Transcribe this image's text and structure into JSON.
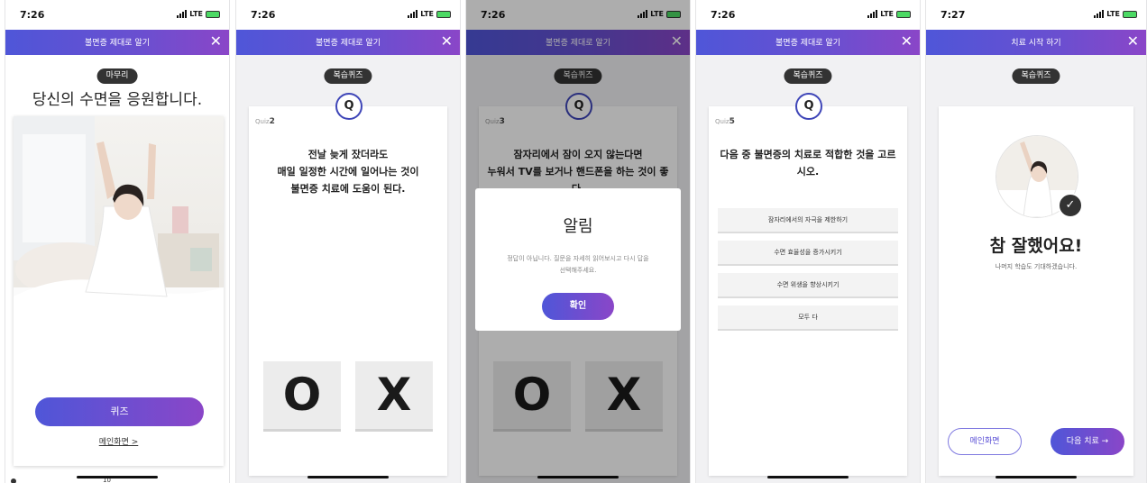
{
  "phones": [
    {
      "time": "7:26",
      "network": "LTE",
      "header_title": "불면증 제대로 알기",
      "close": "✕",
      "section_pill": "마무리",
      "heading": "당신의 수면을 응원합니다.",
      "quiz_button": "퀴즈",
      "main_link": "메인화면 >",
      "bottom_count": "10"
    },
    {
      "time": "7:26",
      "network": "LTE",
      "header_title": "불면증 제대로 알기",
      "close": "✕",
      "section_pill": "복습퀴즈",
      "q_badge": "Q",
      "quiz_prefix": "Quiz",
      "quiz_number": "2",
      "question_lines": [
        "전날 늦게 잤더라도",
        "매일 일정한 시간에 일어나는 것이",
        "불면증 치료에 도움이 된다."
      ],
      "o_label": "O",
      "x_label": "X"
    },
    {
      "time": "7:26",
      "network": "LTE",
      "header_title": "불면증 제대로 알기",
      "close": "✕",
      "section_pill": "복습퀴즈",
      "q_badge": "Q",
      "quiz_prefix": "Quiz",
      "quiz_number": "3",
      "question_lines": [
        "잠자리에서 잠이 오지 않는다면",
        "누워서 TV를 보거나 핸드폰을 하는 것이 좋",
        "다."
      ],
      "o_label": "O",
      "x_label": "X",
      "alert_title": "알림",
      "alert_lines": [
        "정답이 아닙니다. 질문을 자세히 읽어보시고 다시 답을",
        "선택해주세요."
      ],
      "alert_button": "확인"
    },
    {
      "time": "7:26",
      "network": "LTE",
      "header_title": "불면증 제대로 알기",
      "close": "✕",
      "section_pill": "복습퀴즈",
      "q_badge": "Q",
      "quiz_prefix": "Quiz",
      "quiz_number": "5",
      "question_lines": [
        "다음 중 불면증의 치료로 적합한 것을 고르",
        "시오."
      ],
      "options": [
        "잠자리에서의 자극을 제한하기",
        "수면 효율성을 증가시키기",
        "수면 위생을 향상시키기",
        "모두 다"
      ]
    },
    {
      "time": "7:27",
      "network": "LTE",
      "header_title": "치료 시작 하기",
      "close": "✕",
      "section_pill": "복습퀴즈",
      "result_title": "참 잘했어요!",
      "result_sub": "나머지 학습도 기대하겠습니다.",
      "main_button": "메인화면",
      "next_button": "다음 치료 →"
    }
  ],
  "colors": {
    "header_start": "#4f56d8",
    "header_end": "#8a46c8",
    "pill_bg": "#333333",
    "accent": "#5a4fd6"
  },
  "icons": [
    "close-icon",
    "check-icon",
    "signal-bars-icon",
    "battery-icon",
    "location-arrow-icon"
  ]
}
